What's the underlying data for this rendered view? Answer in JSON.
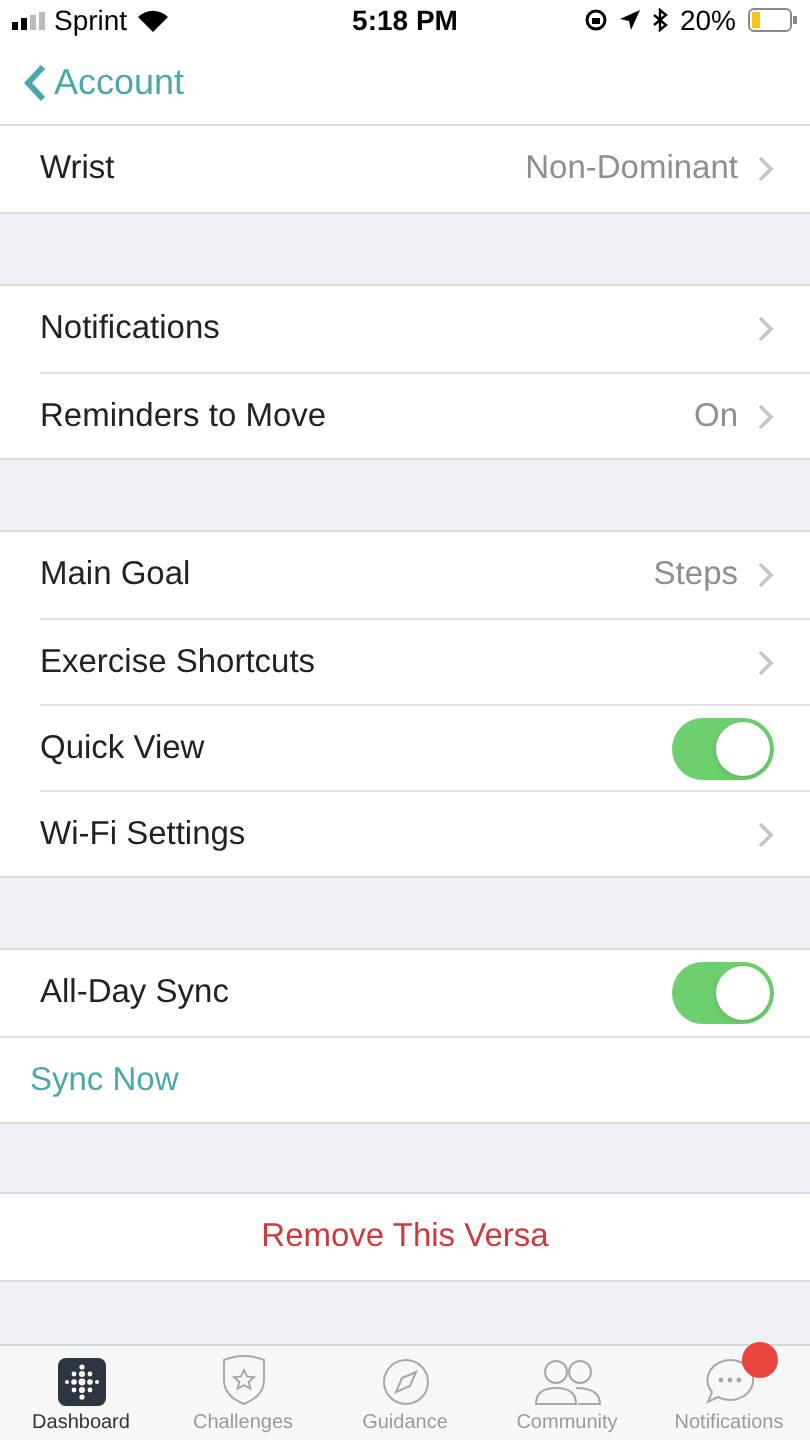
{
  "status_bar": {
    "carrier": "Sprint",
    "time": "5:18 PM",
    "battery": "20%"
  },
  "nav": {
    "back": "Account"
  },
  "groups": [
    {
      "rows": [
        {
          "kind": "disclosure",
          "label": "Wrist",
          "value": "Non-Dominant"
        }
      ]
    },
    {
      "rows": [
        {
          "kind": "disclosure",
          "label": "Notifications"
        },
        {
          "kind": "disclosure",
          "label": "Reminders to Move",
          "value": "On"
        }
      ]
    },
    {
      "rows": [
        {
          "kind": "disclosure",
          "label": "Main Goal",
          "value": "Steps"
        },
        {
          "kind": "disclosure",
          "label": "Exercise Shortcuts"
        },
        {
          "kind": "toggle",
          "label": "Quick View",
          "on": true
        },
        {
          "kind": "disclosure",
          "label": "Wi-Fi Settings"
        }
      ]
    },
    {
      "rows": [
        {
          "kind": "toggle",
          "label": "All-Day Sync",
          "on": true
        },
        {
          "kind": "action",
          "label": "Sync Now"
        }
      ]
    },
    {
      "rows": [
        {
          "kind": "destructive",
          "label": "Remove This Versa"
        }
      ]
    }
  ],
  "tabs": [
    {
      "kind": "dashboard",
      "label": "Dashboard",
      "selected": true,
      "badge": false
    },
    {
      "kind": "challenges",
      "label": "Challenges",
      "selected": false,
      "badge": false
    },
    {
      "kind": "guidance",
      "label": "Guidance",
      "selected": false,
      "badge": false
    },
    {
      "kind": "community",
      "label": "Community",
      "selected": false,
      "badge": false
    },
    {
      "kind": "notifications",
      "label": "Notifications",
      "selected": false,
      "badge": true
    }
  ]
}
